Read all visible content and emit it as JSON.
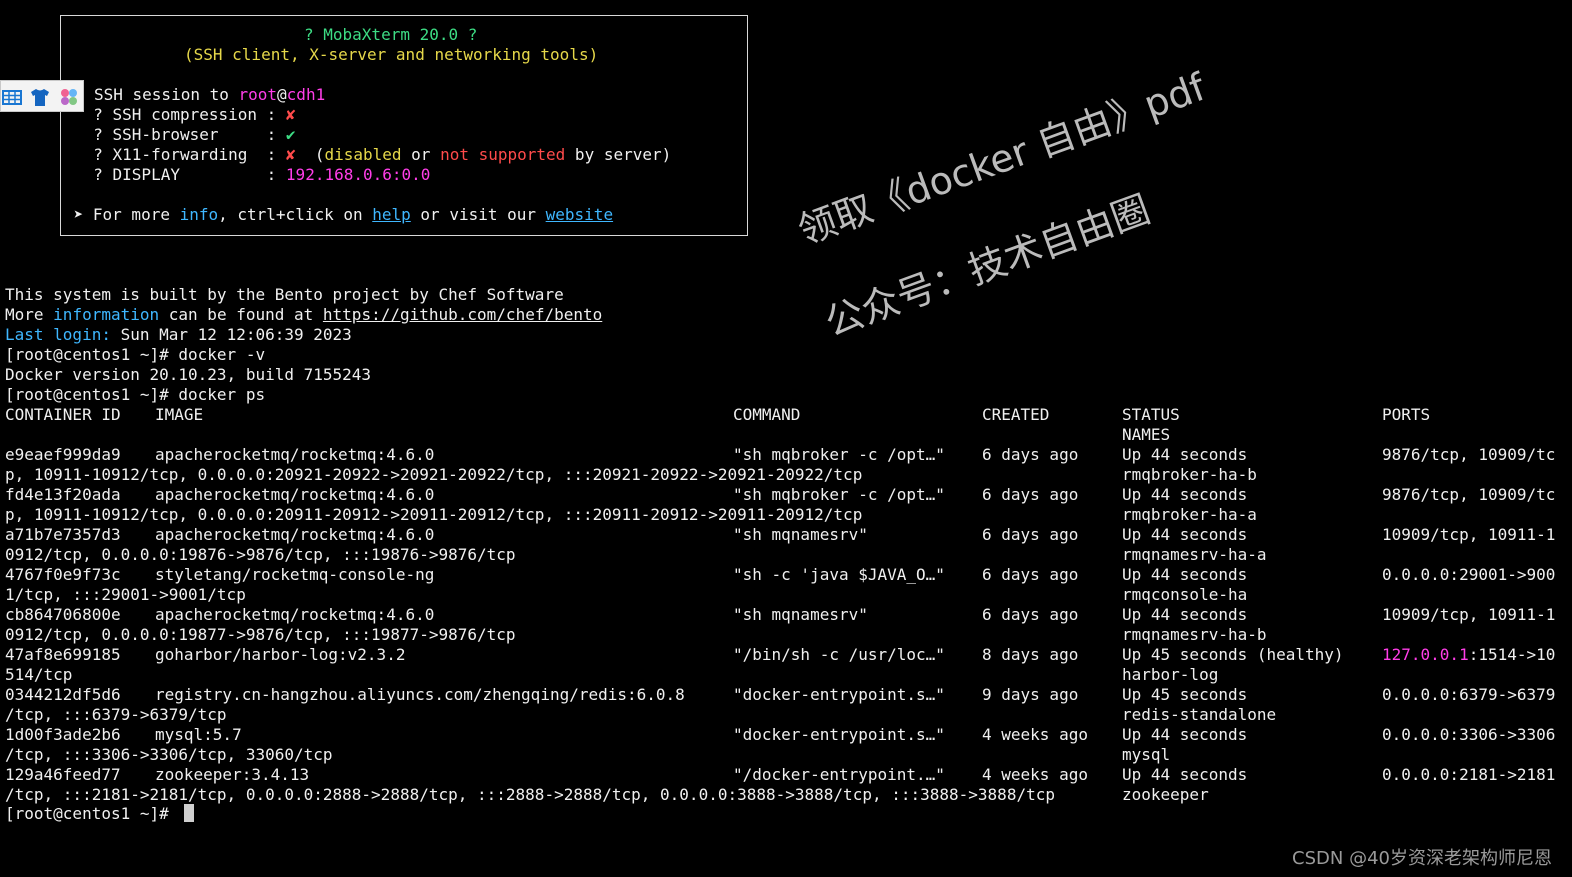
{
  "banner": {
    "title": "? MobaXterm 20.0 ?",
    "subtitle": "(SSH client, X-server and networking tools)",
    "session_prefix": "SSH session to ",
    "session_user": "root",
    "session_at": "@",
    "session_host": "cdh1",
    "compression_label": "  ? SSH compression : ",
    "compression_value": "✘",
    "browser_label": "  ? SSH-browser     : ",
    "browser_value": "✔",
    "x11_label": "  ? X11-forwarding  : ",
    "x11_value": "✘",
    "x11_note_open": "  (",
    "x11_note_disabled": "disabled",
    "x11_note_or": " or ",
    "x11_note_not_supported": "not supported",
    "x11_note_tail": " by server)",
    "display_label": "  ? DISPLAY         : ",
    "display_value": "192.168.0.6:0.0",
    "more_prefix": " ➤ For more ",
    "more_info": "info",
    "more_mid": ", ctrl+click on ",
    "more_help": "help",
    "more_or": " or visit our ",
    "more_website": "website"
  },
  "motd": {
    "line1": "This system is built by the Bento project by Chef Software",
    "line2_prefix": "More ",
    "line2_info": "information",
    "line2_mid": " can be found at ",
    "line2_url": "https://github.com/chef/bento",
    "last_login_label": "Last login:",
    "last_login_value": " Sun Mar 12 12:06:39 2023"
  },
  "terminal": {
    "prompt": "[root@centos1 ~]# ",
    "cmd1": "docker -v",
    "docker_version": "Docker version 20.10.23, build 7155243",
    "cmd2": "docker ps",
    "headers": {
      "container_id": "CONTAINER ID",
      "image": "IMAGE",
      "command": "COMMAND",
      "created": "CREATED",
      "status": "STATUS",
      "names": "NAMES",
      "ports": "PORTS"
    },
    "rows": [
      {
        "id": "e9eaef999da9",
        "image": "apacherocketmq/rocketmq:4.6.0",
        "command": "\"sh mqbroker -c /opt…\"",
        "created": "6 days ago",
        "status": "Up 44 seconds",
        "ports_head": "9876/tcp, 10909/tc",
        "ports_tail": "p, 10911-10912/tcp, 0.0.0.0:20921-20922->20921-20922/tcp, :::20921-20922->20921-20922/tcp",
        "name": "rmqbroker-ha-b"
      },
      {
        "id": "fd4e13f20ada",
        "image": "apacherocketmq/rocketmq:4.6.0",
        "command": "\"sh mqbroker -c /opt…\"",
        "created": "6 days ago",
        "status": "Up 44 seconds",
        "ports_head": "9876/tcp, 10909/tc",
        "ports_tail": "p, 10911-10912/tcp, 0.0.0.0:20911-20912->20911-20912/tcp, :::20911-20912->20911-20912/tcp",
        "name": "rmqbroker-ha-a"
      },
      {
        "id": "a71b7e7357d3",
        "image": "apacherocketmq/rocketmq:4.6.0",
        "command": "\"sh mqnamesrv\"",
        "created": "6 days ago",
        "status": "Up 44 seconds",
        "ports_head": "10909/tcp, 10911-1",
        "ports_tail": "0912/tcp, 0.0.0.0:19876->9876/tcp, :::19876->9876/tcp",
        "name": "rmqnamesrv-ha-a"
      },
      {
        "id": "4767f0e9f73c",
        "image": "styletang/rocketmq-console-ng",
        "command": "\"sh -c 'java $JAVA_O…\"",
        "created": "6 days ago",
        "status": "Up 44 seconds",
        "ports_head": "0.0.0.0:29001->900",
        "ports_tail": "1/tcp, :::29001->9001/tcp",
        "name": "rmqconsole-ha"
      },
      {
        "id": "cb864706800e",
        "image": "apacherocketmq/rocketmq:4.6.0",
        "command": "\"sh mqnamesrv\"",
        "created": "6 days ago",
        "status": "Up 44 seconds",
        "ports_head": "10909/tcp, 10911-1",
        "ports_tail": "0912/tcp, 0.0.0.0:19877->9876/tcp, :::19877->9876/tcp",
        "name": "rmqnamesrv-ha-b"
      },
      {
        "id": "47af8e699185",
        "image": "goharbor/harbor-log:v2.3.2",
        "command": "\"/bin/sh -c /usr/loc…\"",
        "created": "8 days ago",
        "status": "Up 45 seconds (healthy)",
        "ports_head_ip": "127.0.0.1",
        "ports_head": ":1514->10",
        "ports_tail": "514/tcp",
        "name": "harbor-log"
      },
      {
        "id": "0344212df5d6",
        "image": "registry.cn-hangzhou.aliyuncs.com/zhengqing/redis:6.0.8",
        "command": "\"docker-entrypoint.s…\"",
        "created": "9 days ago",
        "status": "Up 45 seconds",
        "ports_head": "0.0.0.0:6379->6379",
        "ports_tail": "/tcp, :::6379->6379/tcp",
        "name": "redis-standalone"
      },
      {
        "id": "1d00f3ade2b6",
        "image": "mysql:5.7",
        "command": "\"docker-entrypoint.s…\"",
        "created": "4 weeks ago",
        "status": "Up 44 seconds",
        "ports_head": "0.0.0.0:3306->3306",
        "ports_tail": "/tcp, :::3306->3306/tcp, 33060/tcp",
        "name": "mysql"
      },
      {
        "id": "129a46feed77",
        "image": "zookeeper:3.4.13",
        "command": "\"/docker-entrypoint.…\"",
        "created": "4 weeks ago",
        "status": "Up 44 seconds",
        "ports_head": "0.0.0.0:2181->2181",
        "ports_tail": "/tcp, :::2181->2181/tcp, 0.0.0.0:2888->2888/tcp, :::2888->2888/tcp, 0.0.0.0:3888->3888/tcp, :::3888->3888/tcp",
        "name": "zookeeper"
      }
    ]
  },
  "watermark": {
    "line1": "领取《docker 自由》pdf",
    "line2": "公众号：技术自由圈"
  },
  "footer": {
    "csdn": "CSDN @40岁资深老架构师尼恩"
  },
  "icons": {
    "toolbar": [
      "grid-icon",
      "shirt-icon",
      "palette-icon"
    ]
  },
  "colors": {
    "background": "#000000",
    "green": "#3ddc84",
    "yellow": "#e6d84a",
    "magenta": "#ff3ee8",
    "red": "#ff4b4b",
    "cyan": "#3fb7ff"
  }
}
